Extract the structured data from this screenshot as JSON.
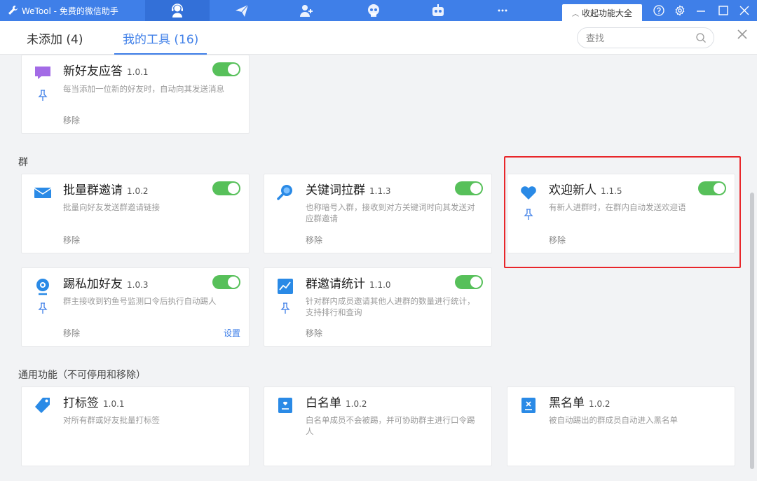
{
  "app": {
    "title": "WeTool - 免费的微信助手"
  },
  "titlebar": {
    "collapse_label": "收起功能大全"
  },
  "tabs": [
    {
      "label": "未添加 (4)"
    },
    {
      "label": "我的工具 (16)"
    }
  ],
  "search": {
    "placeholder": "查找"
  },
  "sections": {
    "group": "群",
    "general": "通用功能（不可停用和移除）"
  },
  "cards": {
    "new_friend": {
      "title": "新好友应答",
      "version": "1.0.1",
      "desc": "每当添加一位新的好友时，自动向其发送消息",
      "remove": "移除"
    },
    "batch_invite": {
      "title": "批量群邀请",
      "version": "1.0.2",
      "desc": "批量向好友发送群邀请链接",
      "remove": "移除"
    },
    "keyword_pull": {
      "title": "关键词拉群",
      "version": "1.1.3",
      "desc": "也称暗号入群，接收到对方关键词时向其发送对应群邀请",
      "remove": "移除"
    },
    "welcome": {
      "title": "欢迎新人",
      "version": "1.1.5",
      "desc": "有新人进群时，在群内自动发送欢迎语",
      "remove": "移除"
    },
    "kick_add": {
      "title": "踢私加好友",
      "version": "1.0.3",
      "desc": "群主接收到钓鱼号监测口令后执行自动踢人",
      "remove": "移除",
      "settings": "设置"
    },
    "invite_stats": {
      "title": "群邀请统计",
      "version": "1.1.0",
      "desc": "针对群内成员邀请其他人进群的数量进行统计，支持排行和查询",
      "remove": "移除"
    },
    "tag": {
      "title": "打标签",
      "version": "1.0.1",
      "desc": "对所有群或好友批量打标签"
    },
    "whitelist": {
      "title": "白名单",
      "version": "1.0.2",
      "desc": "白名单成员不会被踢，并可协助群主进行口令踢人"
    },
    "blacklist": {
      "title": "黑名单",
      "version": "1.0.2",
      "desc": "被自动踢出的群成员自动进入黑名单"
    }
  },
  "colors": {
    "accent": "#3f7fe8",
    "toggle_on": "#57c05a",
    "highlight": "#e8262a"
  }
}
